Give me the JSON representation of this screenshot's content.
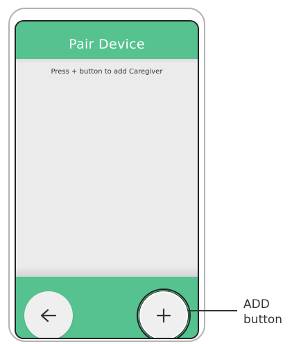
{
  "screen": {
    "header": {
      "title": "Pair Device"
    },
    "content": {
      "instruction": "Press + button to add Caregiver"
    },
    "footer": {
      "back_icon": "arrow-left-icon",
      "add_icon": "plus-icon"
    }
  },
  "callout": {
    "line1": "ADD",
    "line2": "button"
  },
  "colors": {
    "accent": "#55c290",
    "screen_bg": "#ebebeb",
    "button_bg": "#efefef"
  }
}
